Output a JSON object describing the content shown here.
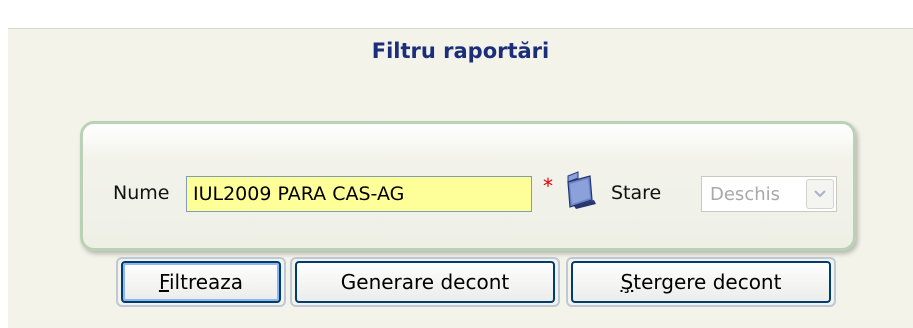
{
  "panel": {
    "title": "Filtru raportări"
  },
  "filter": {
    "name_label": "Nume",
    "name_value": "IUL2009 PARA CAS-AG",
    "required_mark": "*",
    "folder_icon": "folder-icon",
    "state_label": "Stare",
    "state_value": "Deschis",
    "state_arrow_icon": "chevron-down-icon"
  },
  "buttons": {
    "filter_mnemonic": "F",
    "filter_rest": "iltreaza",
    "generate_label": "Generare decont",
    "delete_mnemonic": "Ş",
    "delete_rest": "tergere decont"
  },
  "colors": {
    "title": "#1a2e7a",
    "input_background": "#ffff99",
    "required": "#e00000",
    "button_border": "#003c74"
  }
}
